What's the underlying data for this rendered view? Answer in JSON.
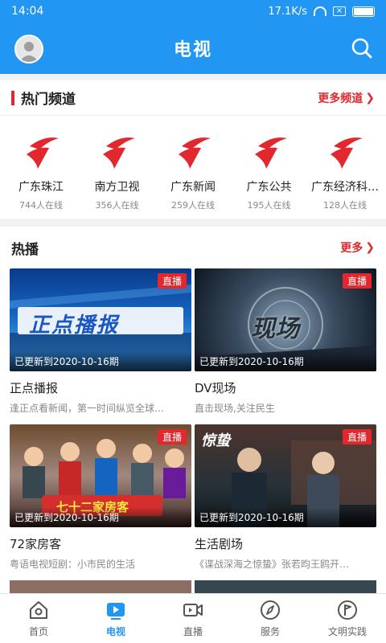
{
  "status": {
    "time": "14:04",
    "speed": "17.1K/s"
  },
  "header": {
    "title": "电视"
  },
  "hot_channels": {
    "title": "热门频道",
    "more": "更多频道",
    "items": [
      {
        "name": "广东珠江",
        "viewers": "744人在线"
      },
      {
        "name": "南方卫视",
        "viewers": "356人在线"
      },
      {
        "name": "广东新闻",
        "viewers": "259人在线"
      },
      {
        "name": "广东公共",
        "viewers": "195人在线"
      },
      {
        "name": "广东经济科…",
        "viewers": "128人在线"
      }
    ]
  },
  "hot_play": {
    "title": "热播",
    "more": "更多",
    "live_label": "直播",
    "items": [
      {
        "title": "正点播报",
        "desc": "逢正点看新闻，第一时间纵览全球…",
        "update": "已更新到2020-10-16期",
        "thumb_text": "正点播报"
      },
      {
        "title": "DV现场",
        "desc": "直击现场,关注民生",
        "update": "已更新到2020-10-16期",
        "thumb_text": "现场"
      },
      {
        "title": "72家房客",
        "desc": "粤语电视短剧：小市民的生活",
        "update": "已更新到2020-10-16期",
        "thumb_text": "七十二家房客"
      },
      {
        "title": "生活剧场",
        "desc": "《谍战深海之惊蛰》张若昀王鸥开…",
        "update": "已更新到2020-10-16期",
        "thumb_text": "惊蛰"
      }
    ]
  },
  "tabs": [
    {
      "label": "首页",
      "icon": "home-icon"
    },
    {
      "label": "电视",
      "icon": "tv-play-icon"
    },
    {
      "label": "直播",
      "icon": "video-camera-icon"
    },
    {
      "label": "服务",
      "icon": "compass-icon"
    },
    {
      "label": "文明实践",
      "icon": "flag-icon"
    }
  ],
  "colors": {
    "primary": "#2196f3",
    "accent": "#e0282e"
  }
}
